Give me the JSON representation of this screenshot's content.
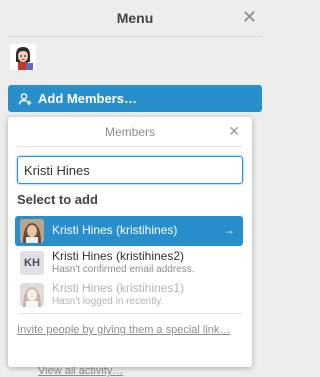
{
  "menu": {
    "title": "Menu",
    "close_icon": "close-icon",
    "add_members_label": "Add Members…",
    "add_members_icon": "add-person-icon",
    "view_all_activity": "View all activity…"
  },
  "popover": {
    "title": "Members",
    "close_icon": "close-icon",
    "search_value": "Kristi Hines",
    "section_label": "Select to add",
    "results": [
      {
        "name": "Kristi Hines (kristihines)",
        "subtitle": "",
        "avatar": "photo",
        "selected": true,
        "arrow": "→"
      },
      {
        "name": "Kristi Hines (kristihines2)",
        "subtitle": "Hasn't confirmed email address.",
        "avatar_initials": "KH",
        "selected": false
      },
      {
        "name": "Kristi Hines (kristihines1)",
        "subtitle": "Hasn't logged in recently.",
        "avatar": "photo",
        "selected": false,
        "faded": true
      }
    ],
    "invite_link": "Invite people by giving them a special link…"
  },
  "colors": {
    "accent": "#298fca",
    "panel_bg": "#ededed",
    "muted_text": "#8c8c8c"
  }
}
